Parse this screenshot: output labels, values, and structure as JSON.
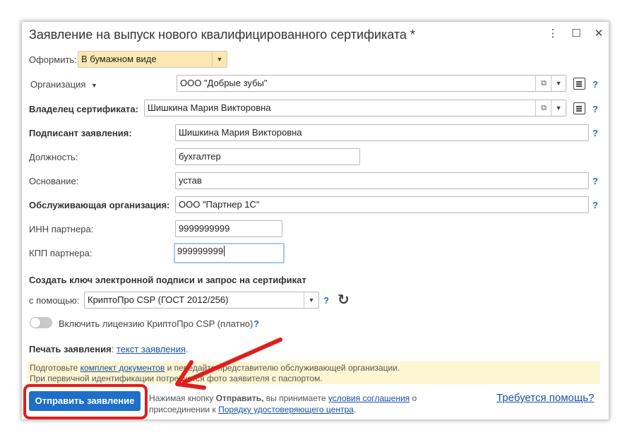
{
  "window": {
    "title": "Заявление на выпуск нового квалифицированного сертификата *",
    "controls": {
      "menu": "⋮",
      "maximize": "☐",
      "close": "✕"
    }
  },
  "form": {
    "format": {
      "label": "Оформить:",
      "value": "В бумажном виде"
    },
    "organization": {
      "label": "Организация",
      "value": "ООО \"Добрые зубы\""
    },
    "owner": {
      "label": "Владелец сертификата:",
      "value": "Шишкина Мария Викторовна"
    },
    "signer": {
      "label": "Подписант заявления:",
      "value": "Шишкина Мария Викторовна"
    },
    "position": {
      "label": "Должность:",
      "value": "бухгалтер"
    },
    "basis": {
      "label": "Основание:",
      "value": "устав"
    },
    "service_org": {
      "label": "Обслуживающая организация:",
      "value": "ООО \"Партнер 1С\""
    },
    "inn": {
      "label": "ИНН партнера:",
      "value": "9999999999"
    },
    "kpp": {
      "label": "КПП партнера:",
      "value": "999999999"
    },
    "key_section_title": "Создать ключ электронной подписи и запрос на сертификат",
    "provider": {
      "label": "с помощью:",
      "value": "КриптоПро CSP (ГОСТ 2012/256)"
    },
    "license_toggle": {
      "label": "Включить лицензию КриптоПро CSP (платно)",
      "on": false
    },
    "print": {
      "label": "Печать заявления",
      "colon": ":",
      "link": "текст заявления",
      "dot": "."
    },
    "help_mark": "?"
  },
  "notice": {
    "line1_pre": "Подготовьте ",
    "line1_link": "комплект документов",
    "line1_post": " и передайте представителю обслуживающей организации.",
    "line2": "При первичной идентификации потребуется фото заявителя с паспортом."
  },
  "footer": {
    "send_button": "Отправить заявление",
    "agree_pre": "Нажимая кнопку ",
    "agree_bold": "Отправить,",
    "agree_mid": " вы принимаете ",
    "agree_link1": "условия соглашения",
    "agree_mid2": " о",
    "agree_line2_pre": "присоединении к ",
    "agree_link2": "Порядку удостоверяющего центра",
    "agree_end": ".",
    "help_link": "Требуется помощь?"
  },
  "colors": {
    "accent": "#1d6fc9",
    "highlight": "#e21d1d",
    "input_selected": "#fbe8b0",
    "notice_bg": "#fdf6d3"
  }
}
